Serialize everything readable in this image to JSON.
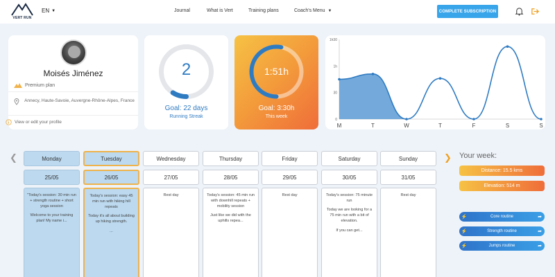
{
  "header": {
    "logo_text": "VERT RUN",
    "language": "EN",
    "nav": [
      {
        "label": "Journal"
      },
      {
        "label": "What is Vert"
      },
      {
        "label": "Training plans"
      },
      {
        "label": "Coach's Menu"
      }
    ],
    "cta_label": "COMPLETE SUBSCRIPTION",
    "icons": [
      "bell-icon",
      "logout-icon"
    ]
  },
  "profile": {
    "name": "Moisés Jiménez",
    "plan": "Premium plan",
    "location": "Annecy, Haute-Savoie, Auvergne-Rhône-Alpes, France",
    "view_link": "View or edit your profile"
  },
  "streak": {
    "value": "2",
    "goal": "Goal: 22 days",
    "label": "Running Streak",
    "progress_fraction": 0.09,
    "color": "#2f7bc2"
  },
  "time": {
    "value": "1:51h",
    "goal": "Goal: 3:30h",
    "label": "This week",
    "progress_fraction": 0.53
  },
  "chart_data": {
    "type": "area",
    "categories": [
      "M",
      "T",
      "W",
      "T",
      "F",
      "S",
      "S"
    ],
    "series": [
      {
        "values": [
          45,
          51,
          0,
          46,
          0,
          82,
          0
        ]
      }
    ],
    "yticks": [
      "0",
      "30",
      "1h",
      "1h30"
    ],
    "ylim": [
      0,
      90
    ],
    "line_color": "#2f7bc2",
    "fill_color": "#5b9bd5"
  },
  "week": {
    "days": [
      {
        "day": "Monday",
        "date": "25/05",
        "state": "past",
        "paragraphs": [
          "\"Today's session: 30 min run + strength routine + short yoga session",
          "Welcome to your training plan! My name i..."
        ]
      },
      {
        "day": "Tuesday",
        "date": "26/05",
        "state": "today",
        "paragraphs": [
          "Today's session: easy 45 min run with hiking hill repeats",
          "Today it's all about building up hiking strength.",
          "..."
        ]
      },
      {
        "day": "Wednesday",
        "date": "27/05",
        "state": "future",
        "paragraphs": [
          "Rest day"
        ]
      },
      {
        "day": "Thursday",
        "date": "28/05",
        "state": "future",
        "paragraphs": [
          "Today's session: 45 min run with downhill repeats + mobility session",
          "Just like we did with the uphills repea..."
        ]
      },
      {
        "day": "Friday",
        "date": "29/05",
        "state": "future",
        "paragraphs": [
          "Rest day"
        ]
      },
      {
        "day": "Saturday",
        "date": "30/05",
        "state": "future",
        "paragraphs": [
          "Today's session: 75 minute run",
          "Today we are looking for a 75 min run with a bit of elevation.",
          "If you can get..."
        ]
      },
      {
        "day": "Sunday",
        "date": "31/05",
        "state": "future",
        "paragraphs": [
          "Rest day"
        ]
      }
    ]
  },
  "summary": {
    "title": "Your week:",
    "distance": "Distance: 15.5 kms",
    "elevation": "Elevation: 514 m"
  },
  "routines": [
    {
      "label": "Core routine"
    },
    {
      "label": "Strength routine"
    },
    {
      "label": "Jumps routine"
    }
  ]
}
